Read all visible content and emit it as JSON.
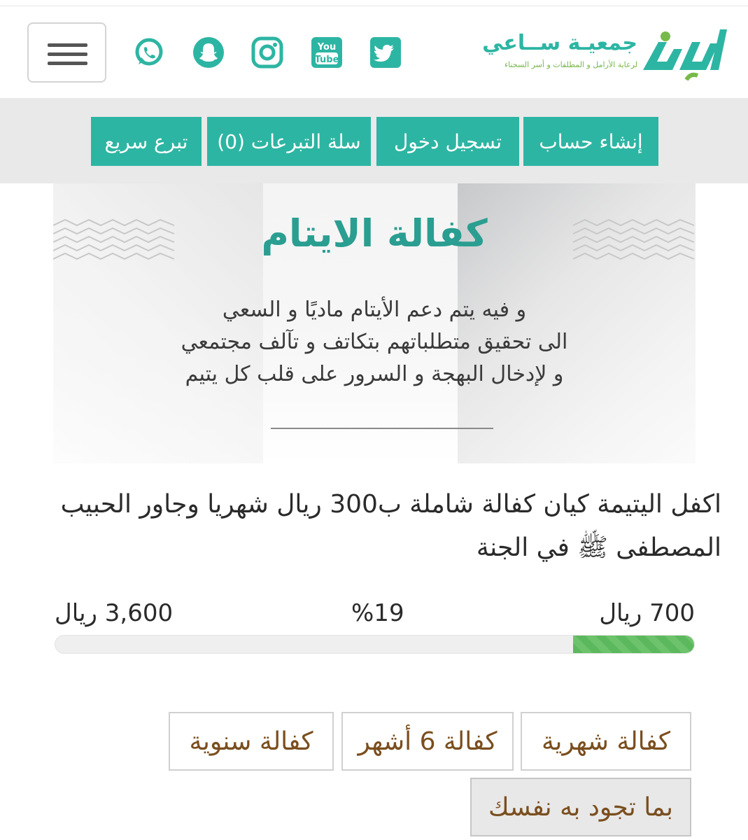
{
  "header": {
    "logo": {
      "name": "جمعيـة ســاعي",
      "subtitle": "لرعاية الأرامل و المطلقات و أسر السجناء"
    },
    "social_icons": [
      "whatsapp-icon",
      "snapchat-icon",
      "instagram-icon",
      "youtube-icon",
      "twitter-icon"
    ],
    "youtube_text_top": "You",
    "youtube_text_bottom": "Tube"
  },
  "nav": {
    "buttons": [
      {
        "label": "إنشاء حساب"
      },
      {
        "label": "تسجيل دخول"
      },
      {
        "label": "سلة التبرعات (0)"
      },
      {
        "label": "تبرع سريع"
      }
    ]
  },
  "banner": {
    "title": "كفالة الايتام",
    "lines": [
      "و فيه يتم دعم الأيتام ماديًا و السعي",
      "الى تحقيق متطلباتهم بتكاتف و تآلف مجتمعي",
      "و لإدخال البهجة و السرور  على قلب كل يتيم"
    ]
  },
  "description": "اكفل اليتيمة كيان كفالة شاملة ب300 ريال شهريا وجاور الحبيب المصطفى ﷺ في الجنة",
  "progress": {
    "collected": "700 ريال",
    "percent_label": "%19",
    "target": "3,600 ريال",
    "fraction": 0.19
  },
  "options": [
    {
      "label": "كفالة شهرية"
    },
    {
      "label": "كفالة 6 أشهر"
    },
    {
      "label": "كفالة سنوية"
    },
    {
      "label": "بما تجود به نفسك"
    }
  ],
  "colors": {
    "brand_teal": "#2db5a3",
    "brand_green": "#77b94a",
    "progress_green": "#5cb85c",
    "option_text": "#7a4e1e"
  }
}
